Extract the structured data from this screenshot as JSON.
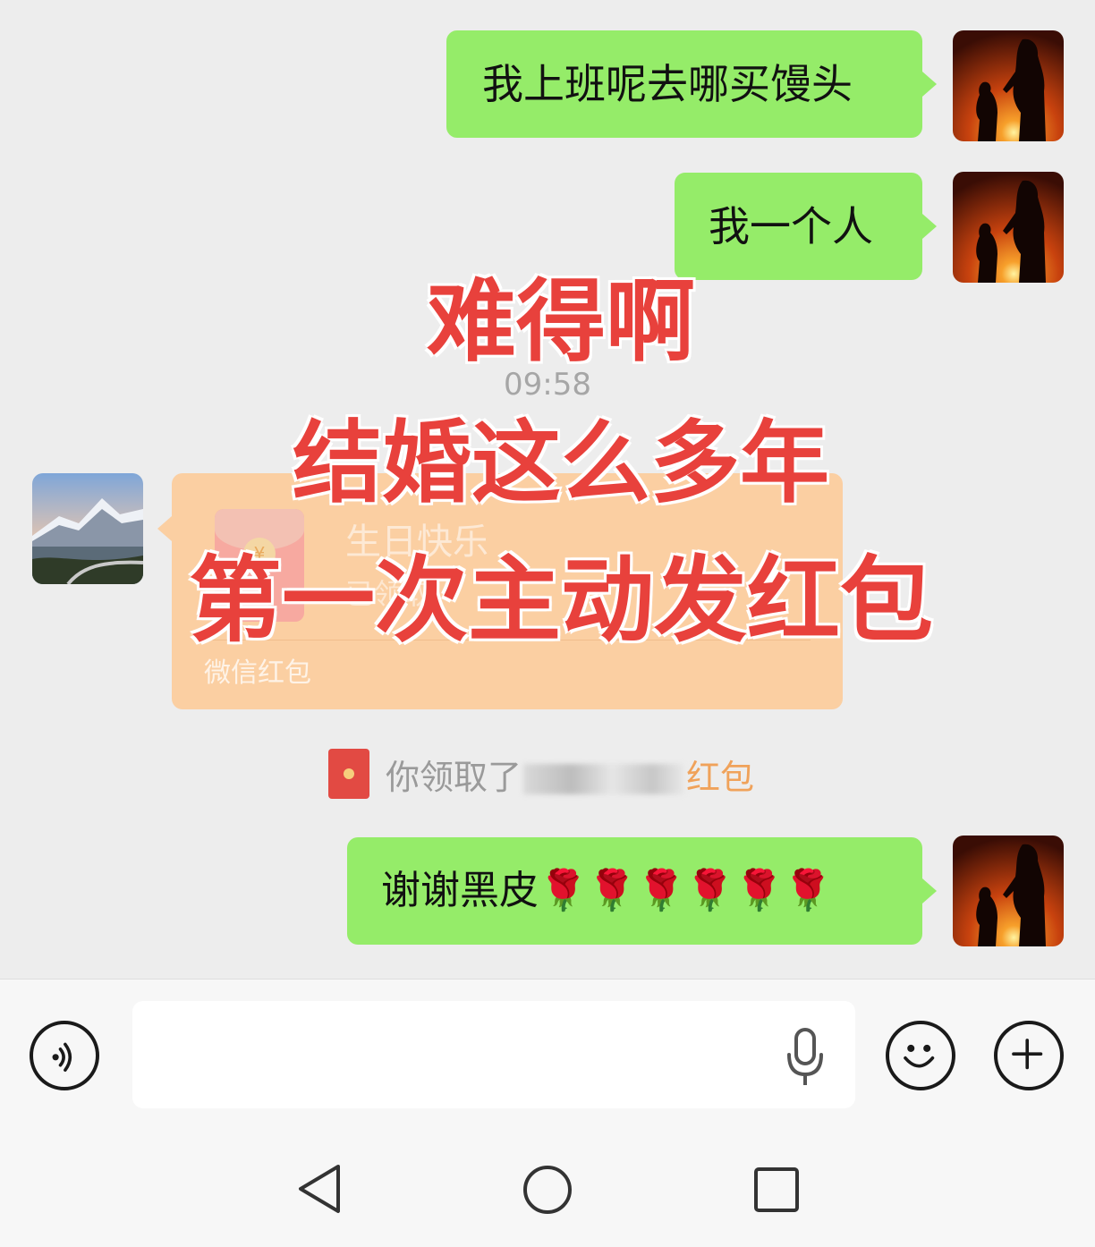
{
  "messages": [
    {
      "text": "我上班呢去哪买馒头",
      "sender": "me"
    },
    {
      "text": "我一个人",
      "sender": "me"
    },
    {
      "text": "谢谢黑皮🌹🌹🌹🌹🌹🌹",
      "sender": "me"
    }
  ],
  "timestamp": "09:58",
  "red_packet": {
    "title": "生日快乐",
    "subtitle": "已领取",
    "label": "微信红包"
  },
  "system_message": {
    "prefix": "你领取了",
    "suffix": "红包"
  },
  "overlay_caption": {
    "line1": "难得啊",
    "line2": "结婚这么多年",
    "line3": "第一次主动发红包"
  },
  "icons": {
    "voice": "voice-icon",
    "mic": "microphone-icon",
    "emoji": "emoji-icon",
    "plus": "plus-icon",
    "back": "nav-back-icon",
    "home": "nav-home-icon",
    "recents": "nav-recents-icon"
  },
  "colors": {
    "outgoing_bubble": "#95ec69",
    "red_packet": "#fbcfa2",
    "overlay_text": "#e8413c",
    "background": "#ededed"
  }
}
